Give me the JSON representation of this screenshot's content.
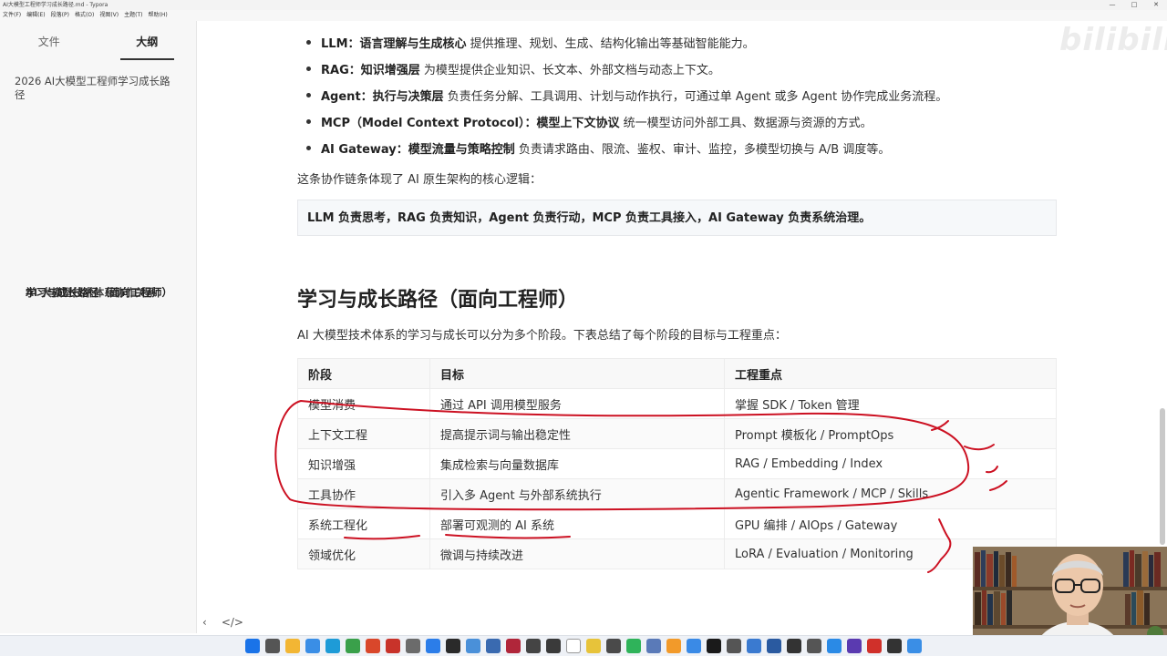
{
  "window": {
    "title": "AI大模型工程师学习成长路径.md - Typora",
    "controls": [
      "—",
      "□",
      "✕"
    ]
  },
  "menu": [
    "文件(F)",
    "编辑(E)",
    "段落(P)",
    "格式(O)",
    "视图(V)",
    "主题(T)",
    "帮助(H)"
  ],
  "sidebar": {
    "tabs": [
      "文件",
      "大纲"
    ],
    "outline": [
      "2026 AI大模型工程师学习成长路径",
      "AI 大模型技术体系协作关系",
      "学习与成长路径（面向工程师）"
    ],
    "footer": [
      "‹",
      "</>"
    ]
  },
  "watermark": "bilibili",
  "content": {
    "bullets": [
      {
        "term": "LLM：语言理解与生成核心",
        "desc": " 提供推理、规划、生成、结构化输出等基础智能能力。"
      },
      {
        "term": "RAG：知识增强层",
        "desc": " 为模型提供企业知识、长文本、外部文档与动态上下文。"
      },
      {
        "term": "Agent：执行与决策层",
        "desc": " 负责任务分解、工具调用、计划与动作执行，可通过单 Agent 或多 Agent 协作完成业务流程。"
      },
      {
        "term": "MCP（Model Context Protocol）：模型上下文协议",
        "desc": " 统一模型访问外部工具、数据源与资源的方式。"
      },
      {
        "term": "AI Gateway：模型流量与策略控制",
        "desc": " 负责请求路由、限流、鉴权、审计、监控，多模型切换与 A/B 调度等。"
      }
    ],
    "summary": "这条协作链条体现了 AI 原生架构的核心逻辑：",
    "callout": "LLM 负责思考，RAG 负责知识，Agent 负责行动，MCP 负责工具接入，AI Gateway 负责系统治理。",
    "heading": "学习与成长路径（面向工程师）",
    "intro": "AI 大模型技术体系的学习与成长可以分为多个阶段。下表总结了每个阶段的目标与工程重点：",
    "table": {
      "headers": [
        "阶段",
        "目标",
        "工程重点"
      ],
      "rows": [
        [
          "模型消费",
          "通过 API 调用模型服务",
          "掌握 SDK / Token 管理"
        ],
        [
          "上下文工程",
          "提高提示词与输出稳定性",
          "Prompt 模板化 / PromptOps"
        ],
        [
          "知识增强",
          "集成检索与向量数据库",
          "RAG / Embedding / Index"
        ],
        [
          "工具协作",
          "引入多 Agent 与外部系统执行",
          "Agentic Framework / MCP / Skills"
        ],
        [
          "系统工程化",
          "部署可观测的 AI 系统",
          "GPU 编排 / AIOps / Gateway"
        ],
        [
          "领域优化",
          "微调与持续改进",
          "LoRA / Evaluation / Monitoring"
        ]
      ]
    }
  },
  "colors": {
    "ink": "#cc1122",
    "sidebar_bg": "#f7f7f7",
    "callout_bg": "#f6f8fa"
  }
}
